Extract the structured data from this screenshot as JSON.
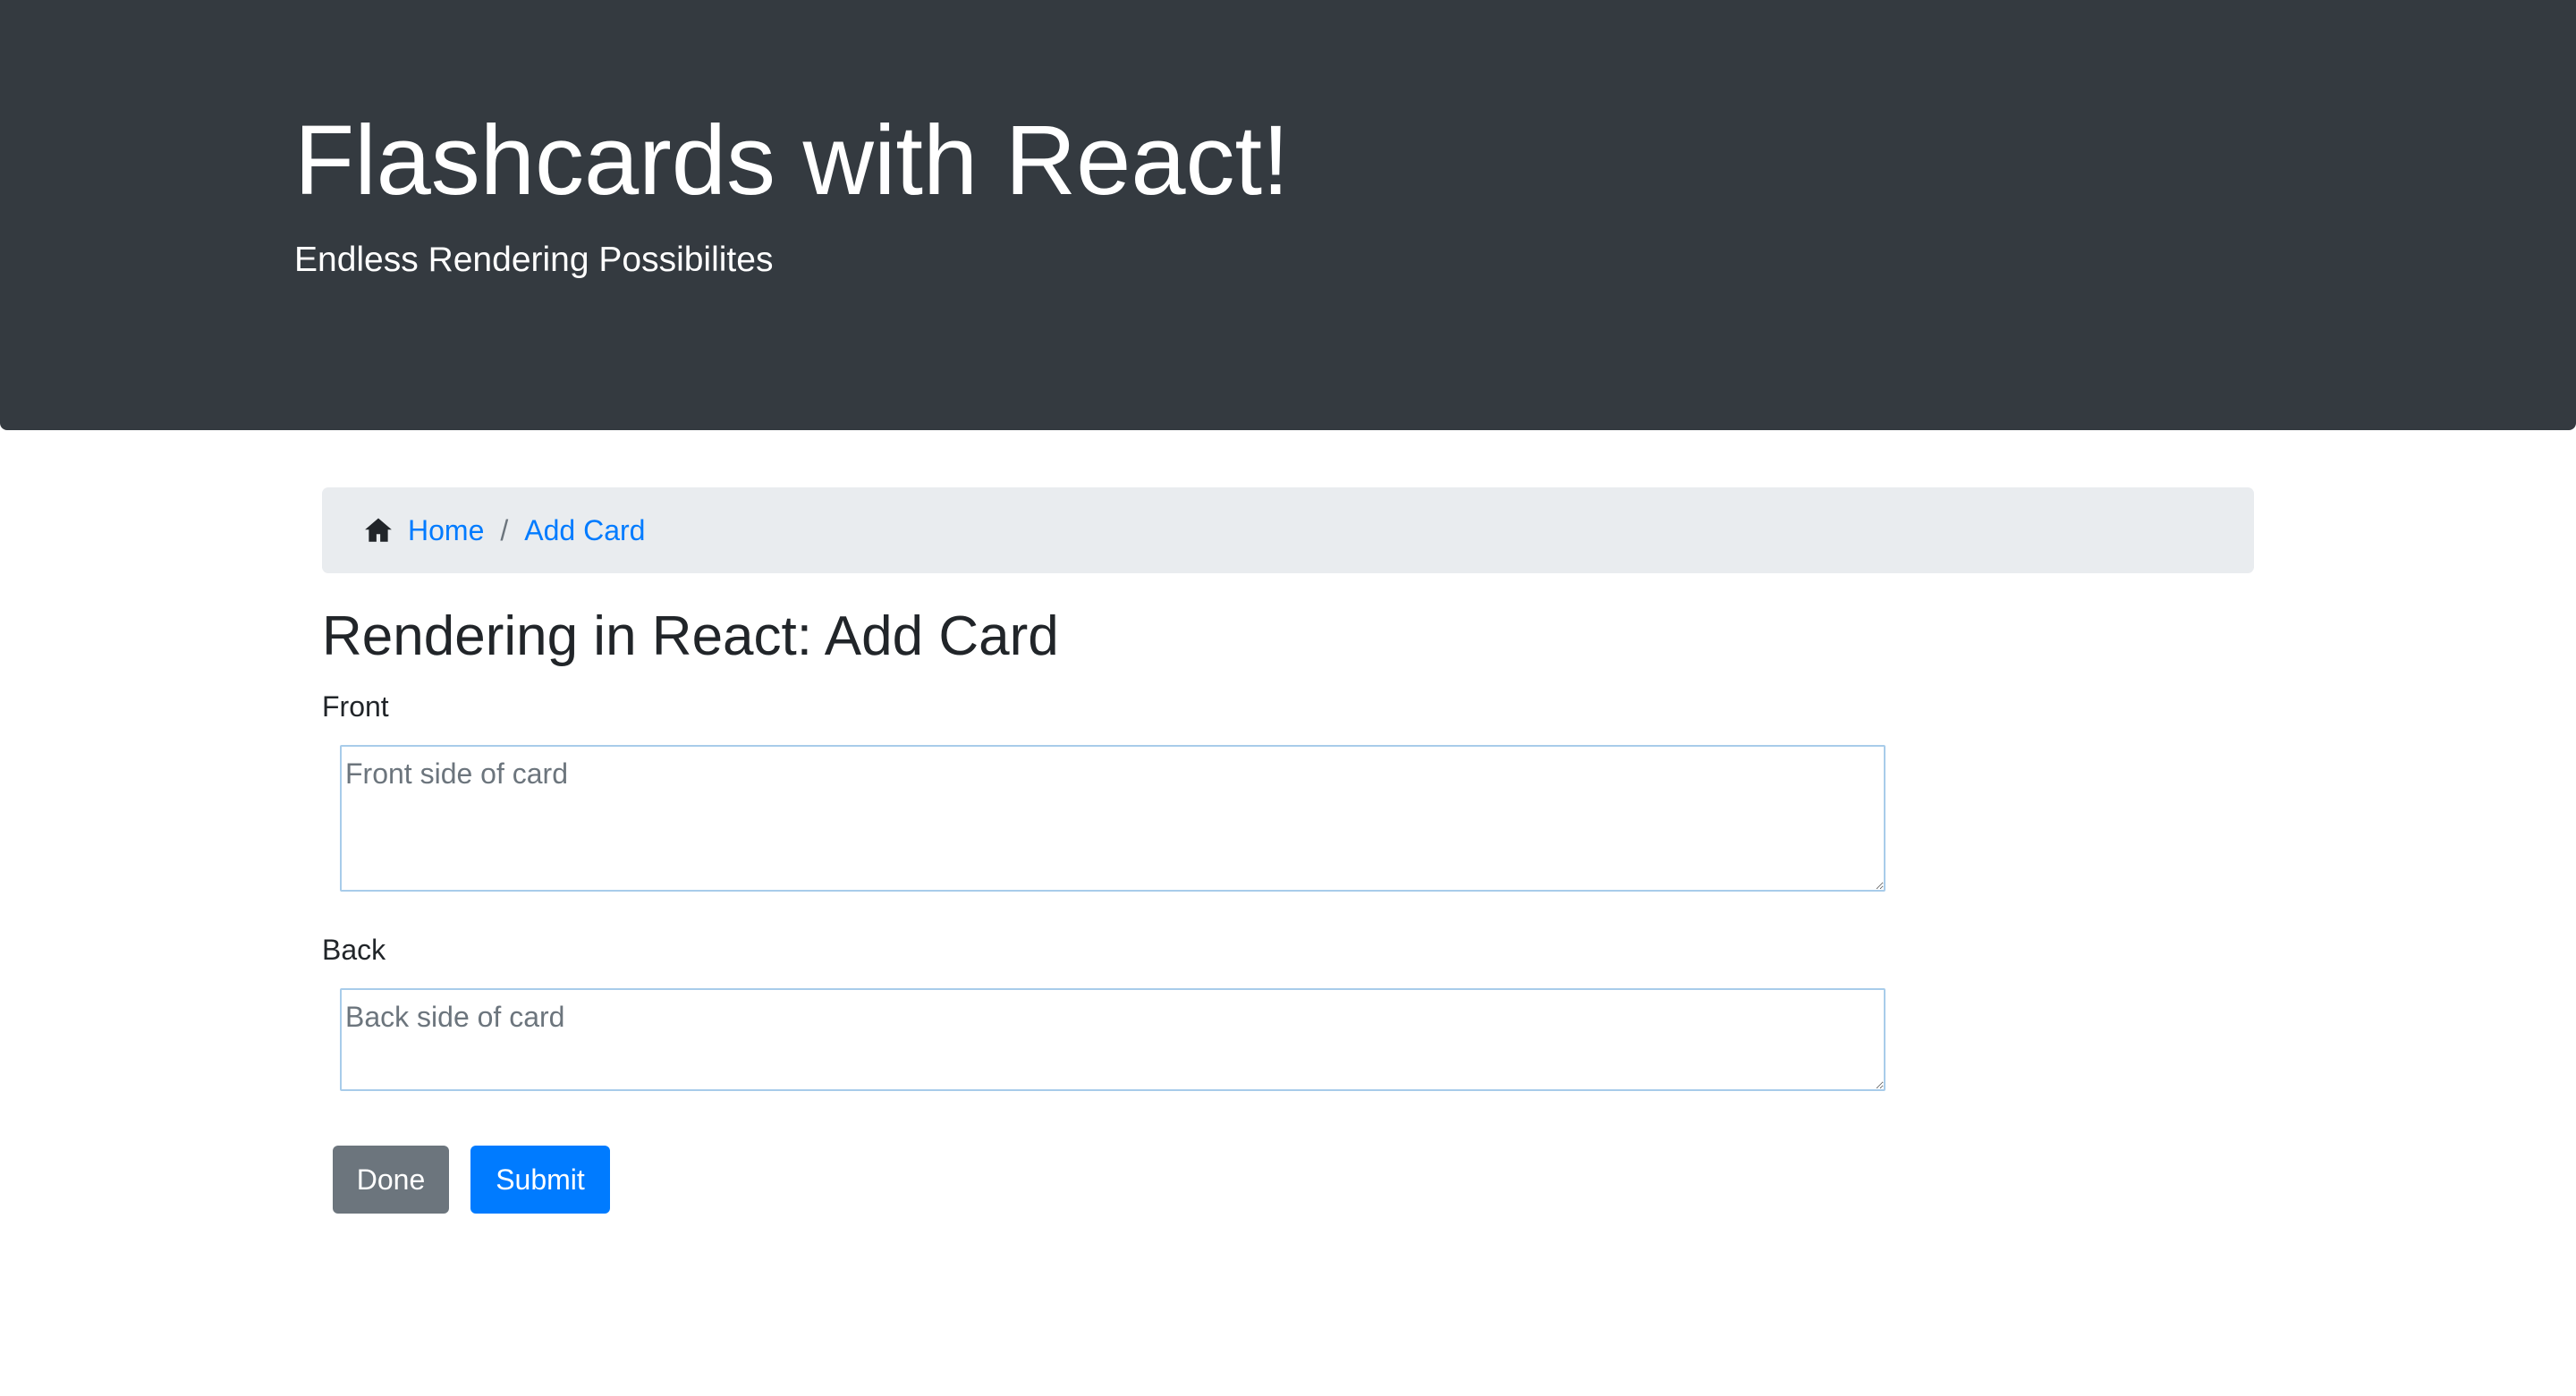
{
  "header": {
    "title": "Flashcards with React!",
    "subtitle": "Endless Rendering Possibilites"
  },
  "breadcrumb": {
    "icon": "home-icon",
    "items": [
      {
        "label": "Home"
      },
      {
        "label": "Add Card"
      }
    ],
    "separator": "/"
  },
  "page": {
    "title": "Rendering in React: Add Card"
  },
  "form": {
    "front": {
      "label": "Front",
      "placeholder": "Front side of card",
      "value": ""
    },
    "back": {
      "label": "Back",
      "placeholder": "Back side of card",
      "value": ""
    }
  },
  "buttons": {
    "done_label": "Done",
    "submit_label": "Submit"
  },
  "colors": {
    "header_bg": "#343a40",
    "breadcrumb_bg": "#e9ecef",
    "link": "#007bff",
    "primary": "#007bff",
    "secondary": "#6c757d"
  }
}
